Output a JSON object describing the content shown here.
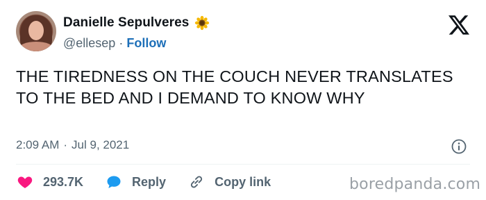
{
  "author": {
    "display_name": "Danielle Sepulveres",
    "name_emoji_icon": "sunflower-icon",
    "handle": "@ellesep",
    "separator": "·",
    "follow_label": "Follow"
  },
  "platform_icon": "x-logo-icon",
  "tweet": {
    "text": "THE TIREDNESS ON THE COUCH NEVER TRANSLATES TO THE BED AND I DEMAND TO KNOW WHY",
    "time": "2:09 AM",
    "separator": "·",
    "date": "Jul 9, 2021",
    "info_icon": "info-icon"
  },
  "actions": {
    "like_count": "293.7K",
    "reply_label": "Reply",
    "copy_link_label": "Copy link"
  },
  "watermark": "boredpanda.com",
  "colors": {
    "text": "#0f1419",
    "muted": "#536471",
    "follow_blue": "#1d6fb8",
    "like_pink": "#f91880",
    "reply_blue": "#1d9bf0",
    "divider": "#eff3f4"
  }
}
